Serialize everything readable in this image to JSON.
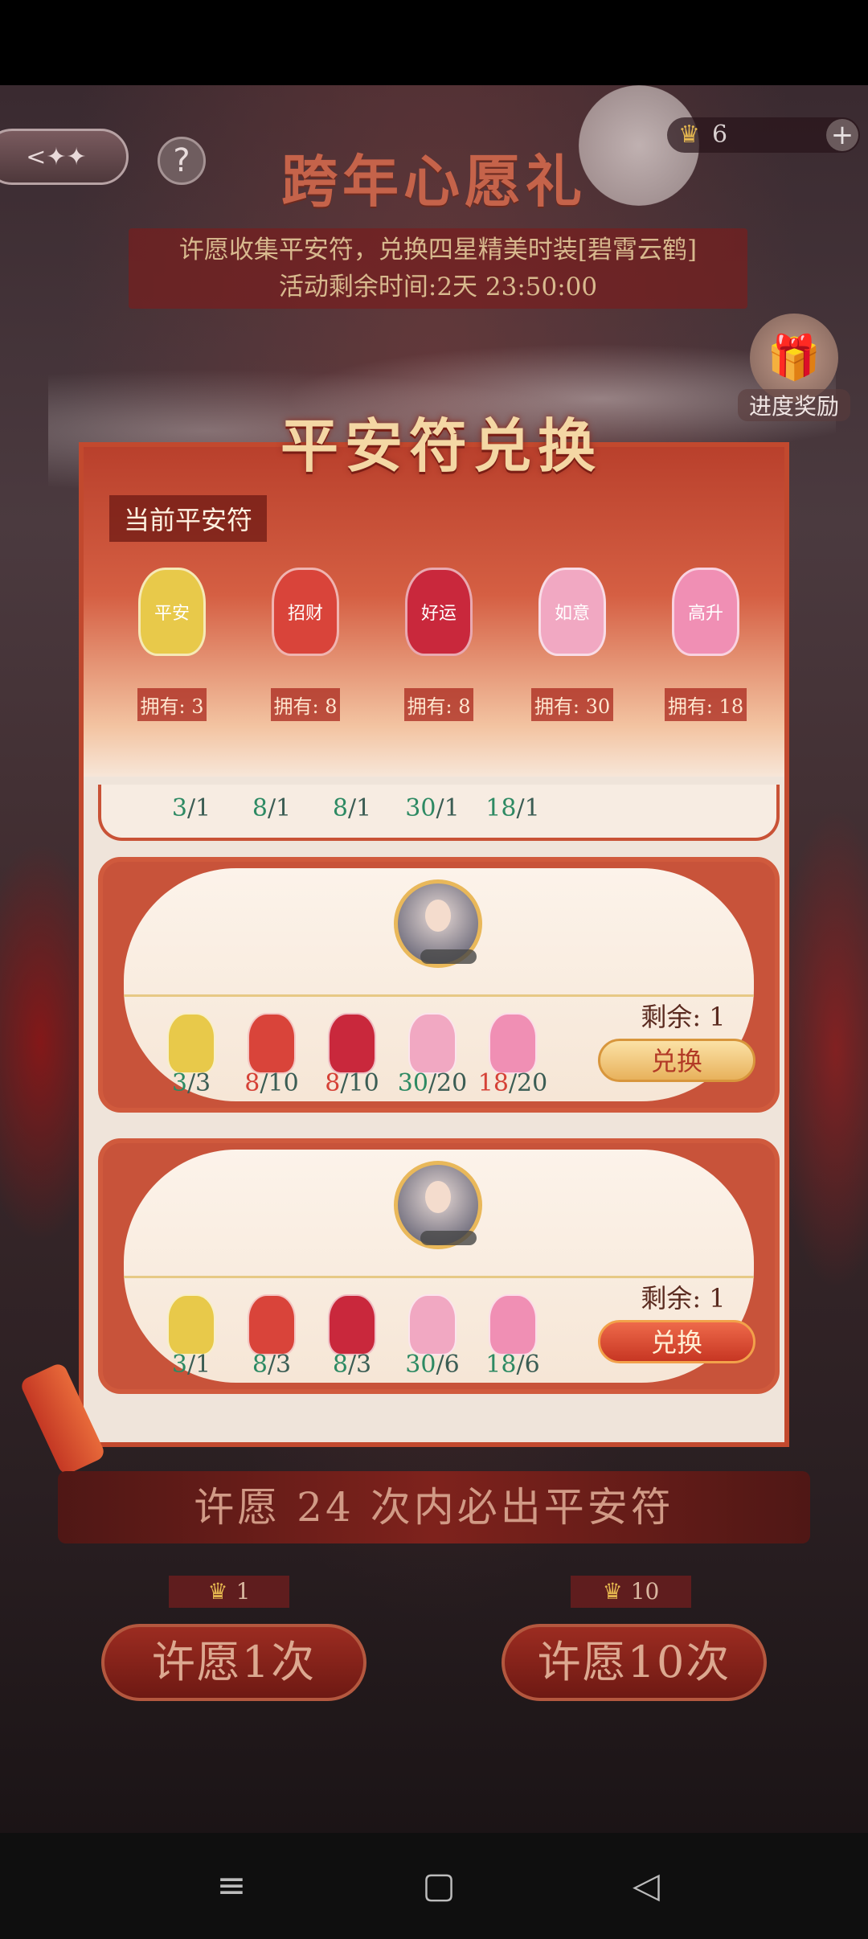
{
  "event": {
    "title": "跨年心愿礼",
    "info_line1": "许愿收集平安符，兑换四星精美时装[碧霄云鹤]",
    "info_line2": "活动剩余时间:2天 23:50:00"
  },
  "topbar": {
    "back_icon": "back-arrow-icon",
    "help_label": "?",
    "currency_amount": "6",
    "plus_label": "+"
  },
  "progress_reward": {
    "label": "进度奖励",
    "icon": "gift-icon"
  },
  "panel": {
    "title": "平安符兑换",
    "current_label": "当前平安符",
    "charms": [
      {
        "name": "平安",
        "owned": "拥有: 3",
        "color": "#e8c94a"
      },
      {
        "name": "招财",
        "owned": "拥有: 8",
        "color": "#d9443a"
      },
      {
        "name": "好运",
        "owned": "拥有: 8",
        "color": "#c9283c"
      },
      {
        "name": "如意",
        "owned": "拥有: 30",
        "color": "#f1a8c2"
      },
      {
        "name": "高升",
        "owned": "拥有: 18",
        "color": "#f08fb4"
      }
    ],
    "partial_row": {
      "counts": [
        {
          "have": "3",
          "need": "1"
        },
        {
          "have": "8",
          "need": "1"
        },
        {
          "have": "8",
          "need": "1"
        },
        {
          "have": "30",
          "need": "1"
        },
        {
          "have": "18",
          "need": "1"
        }
      ]
    },
    "exchanges": [
      {
        "remaining": "剩余: 1",
        "button": "兑换",
        "counts": [
          {
            "have": "3",
            "need": "3",
            "short": false
          },
          {
            "have": "8",
            "need": "10",
            "short": true
          },
          {
            "have": "8",
            "need": "10",
            "short": true
          },
          {
            "have": "30",
            "need": "20",
            "short": false
          },
          {
            "have": "18",
            "need": "20",
            "short": true
          }
        ]
      },
      {
        "remaining": "剩余: 1",
        "button": "兑换",
        "counts": [
          {
            "have": "3",
            "need": "1",
            "short": false
          },
          {
            "have": "8",
            "need": "3",
            "short": false
          },
          {
            "have": "8",
            "need": "3",
            "short": false
          },
          {
            "have": "30",
            "need": "6",
            "short": false
          },
          {
            "have": "18",
            "need": "6",
            "short": false
          }
        ]
      }
    ]
  },
  "wish": {
    "guarantee": "许愿 24 次内必出平安符",
    "single": {
      "cost": "1",
      "label": "许愿1次"
    },
    "ten": {
      "cost": "10",
      "label": "许愿10次"
    }
  },
  "navbar": {
    "menu": "≡",
    "home": "▢",
    "back": "◁"
  }
}
